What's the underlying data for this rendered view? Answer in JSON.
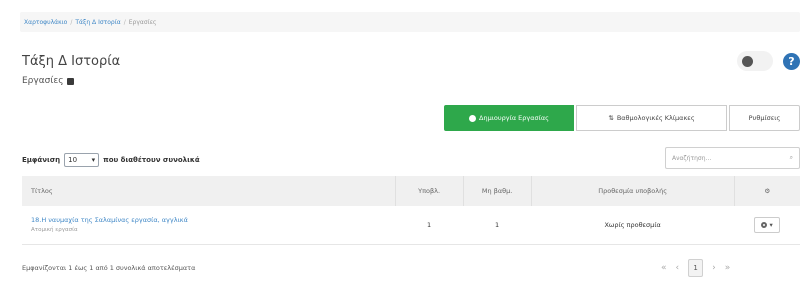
{
  "breadcrumb": {
    "home": "Χαρτοφυλάκιο",
    "course": "Τάξη Δ Ιστορία",
    "current": "Εργασίες"
  },
  "page": {
    "title": "Τάξη Δ Ιστορία",
    "subtitle": "Εργασίες"
  },
  "toolbar": {
    "create": "Δημιουργία Εργασίας",
    "grade_scales": "Βαθμολογικές Κλίμακες",
    "settings": "Ρυθμίσεις"
  },
  "table_controls": {
    "length_prefix": "Εμφάνιση",
    "length_value": "10",
    "length_suffix": "που διαθέτουν συνολικά",
    "search_placeholder": "Αναζήτηση..."
  },
  "table": {
    "headers": [
      "Τίτλος",
      "Υποβλ.",
      "Μη βαθμ.",
      "Προθεσμία υποβολής",
      "⚙"
    ],
    "rows": [
      {
        "title": "18.Η ναυμαχία της Σαλαμίνας εργασία, αγγλικά",
        "type": "Ατομική εργασία",
        "submitted": "1",
        "ungraded": "1",
        "deadline": "Χωρίς προθεσμία",
        "action": "▾"
      }
    ]
  },
  "footer": {
    "info": "Εμφανίζονται 1 έως 1 από 1 συνολικά αποτελέσματα",
    "first": "«",
    "prev": "‹",
    "page": "1",
    "next": "›",
    "last": "»"
  },
  "colors": {
    "primary": "#2f73b5",
    "success": "#2ea84b",
    "link": "#3f87c6"
  }
}
